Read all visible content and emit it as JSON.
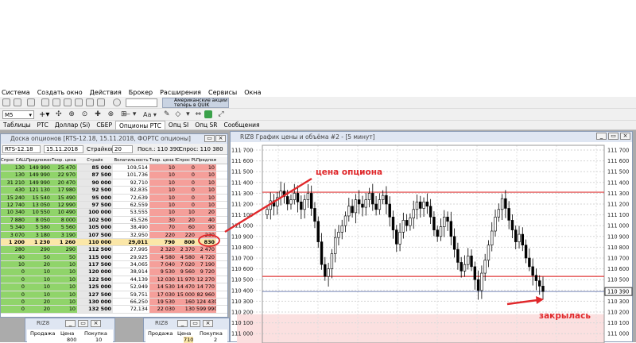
{
  "menu": [
    "Система",
    "Создать окно",
    "Действия",
    "Брокер",
    "Расширения",
    "Сервисы",
    "Окна"
  ],
  "toolbar": {
    "interval": "M5",
    "banner_line1": "Американские акции",
    "banner_line2": "теперь в QUIK"
  },
  "tabs": [
    "Таблицы",
    "РТС",
    "Доллар (Si)",
    "СБЕР",
    "Опционы РТС",
    "Опц SI",
    "Опц SR",
    "Сообщения"
  ],
  "active_tab_index": 4,
  "desk": {
    "title": "Доска опционов [RTS-12.18, 15.11.2018, ФОРТС опционы]",
    "series": "RTS-12.18",
    "date": "15.11.2018",
    "strikes_label": "Страйков:",
    "strikes_value": "20",
    "last_label": "Посл.: 110 390",
    "ask_label": "Спрос: 110 380",
    "headers": [
      "Спрос CALL",
      "Предложение",
      "Теор. цена CALL",
      "Страйк",
      "Волатильность",
      "Теор. цена PUT",
      "Спрос PUT",
      "Предлож. PUT"
    ],
    "rows": [
      [
        "130",
        "149 990",
        "25 470",
        "85 000",
        "109,514",
        "10",
        "0",
        "10"
      ],
      [
        "130",
        "149 990",
        "22 970",
        "87 500",
        "101,736",
        "10",
        "0",
        "10"
      ],
      [
        "31 210",
        "149 990",
        "20 470",
        "90 000",
        "92,710",
        "10",
        "0",
        "10"
      ],
      [
        "430",
        "121 130",
        "17 980",
        "92 500",
        "82,835",
        "10",
        "0",
        "10"
      ],
      [
        "15 240",
        "15 540",
        "15 490",
        "95 000",
        "72,639",
        "10",
        "0",
        "10"
      ],
      [
        "12 740",
        "13 050",
        "12 990",
        "97 500",
        "62,559",
        "10",
        "0",
        "10"
      ],
      [
        "10 340",
        "10 550",
        "10 490",
        "100 000",
        "53,555",
        "10",
        "10",
        "20"
      ],
      [
        "7 880",
        "8 050",
        "8 000",
        "102 500",
        "45,526",
        "30",
        "20",
        "40"
      ],
      [
        "5 340",
        "5 580",
        "5 560",
        "105 000",
        "38,490",
        "70",
        "60",
        "90"
      ],
      [
        "3 070",
        "3 180",
        "3 190",
        "107 500",
        "32,950",
        "220",
        "220",
        "230"
      ],
      [
        "1 200",
        "1 230",
        "1 260",
        "110 000",
        "29,011",
        "790",
        "800",
        "830"
      ],
      [
        "280",
        "290",
        "290",
        "112 500",
        "27,995",
        "2 320",
        "2 370",
        "2 470"
      ],
      [
        "40",
        "50",
        "50",
        "115 000",
        "29,925",
        "4 580",
        "4 580",
        "4 720"
      ],
      [
        "10",
        "20",
        "10",
        "117 500",
        "34,065",
        "7 040",
        "7 020",
        "7 190"
      ],
      [
        "0",
        "10",
        "10",
        "120 000",
        "38,914",
        "9 530",
        "9 560",
        "9 720"
      ],
      [
        "0",
        "10",
        "10",
        "122 500",
        "44,139",
        "12 030",
        "11 970",
        "12 270"
      ],
      [
        "0",
        "10",
        "10",
        "125 000",
        "52,949",
        "14 530",
        "14 470",
        "14 770"
      ],
      [
        "0",
        "10",
        "10",
        "127 500",
        "59,751",
        "17 030",
        "15 000",
        "82 960"
      ],
      [
        "0",
        "20",
        "10",
        "130 000",
        "66,250",
        "19 530",
        "160",
        "124 430"
      ],
      [
        "0",
        "20",
        "10",
        "132 500",
        "72,134",
        "22 030",
        "130",
        "599 990"
      ]
    ],
    "atm_row_index": 10
  },
  "small1": {
    "title": "RIZ8",
    "sell": "Продажа",
    "price": "Цена",
    "buy": "Покупка",
    "row": [
      "",
      "800",
      "10"
    ]
  },
  "small2": {
    "title": "RIZ8",
    "sell": "Продажа",
    "price": "Цена",
    "buy": "Покупка",
    "row": [
      "",
      "710",
      "2"
    ]
  },
  "chart": {
    "title": "RIZ8 График цены и объёма #2 - [5 минут]",
    "current_price_label": "110 390",
    "ann_price": "цена опциона",
    "ann_close": "закрылась"
  },
  "chart_data": {
    "type": "candlestick",
    "ylim": [
      110050,
      111700
    ],
    "y_ticks": [
      111700,
      111600,
      111500,
      111400,
      111300,
      111200,
      111100,
      111000,
      110900,
      110800,
      110700,
      110600,
      110500,
      110400,
      110300,
      110200,
      110100,
      110000
    ],
    "y_tick_labels": [
      "111 700",
      "111 600",
      "111 500",
      "111 400",
      "111 300",
      "111 200",
      "111 100",
      "111 000",
      "110 900",
      "110 800",
      "110 700",
      "110 600",
      "110 500",
      "110 400",
      "110 300",
      "110 200",
      "110 100",
      "111 000"
    ],
    "levels": [
      111310,
      110530
    ],
    "current_price": 110390,
    "closes": [
      111150,
      111230,
      111180,
      111260,
      111320,
      111270,
      111200,
      111240,
      111300,
      111220,
      111150,
      111240,
      111300,
      111160,
      111040,
      110850,
      110640,
      110530,
      110600,
      110740,
      110890,
      110940,
      111000,
      111090,
      111180,
      111120,
      111240,
      111200,
      111170,
      111240,
      111300,
      111200,
      111150,
      111240,
      111280,
      111200,
      111080,
      110960,
      110830,
      110940,
      111050,
      111000,
      111070,
      111150,
      111220,
      111160,
      111220,
      111180,
      111080,
      110960,
      110900,
      110990,
      111080,
      111040,
      110900,
      110780,
      110660,
      110580,
      110640,
      110720,
      110620,
      110500,
      110400,
      110560,
      110680,
      110820,
      110950,
      111080,
      111150,
      111250,
      111160,
      111050,
      110960,
      110850,
      110920,
      110820,
      110700,
      110620,
      110540,
      110490,
      110440,
      110390
    ],
    "opens": [
      111100,
      111150,
      111230,
      111180,
      111260,
      111320,
      111270,
      111200,
      111240,
      111300,
      111220,
      111150,
      111240,
      111300,
      111160,
      111040,
      110850,
      110640,
      110530,
      110600,
      110740,
      110890,
      110940,
      111000,
      111090,
      111180,
      111120,
      111240,
      111200,
      111170,
      111240,
      111300,
      111200,
      111150,
      111240,
      111280,
      111200,
      111080,
      110960,
      110830,
      110940,
      111050,
      111000,
      111070,
      111150,
      111220,
      111160,
      111220,
      111180,
      111080,
      110960,
      110900,
      110990,
      111080,
      111040,
      110900,
      110780,
      110660,
      110580,
      110640,
      110720,
      110620,
      110500,
      110400,
      110560,
      110680,
      110820,
      110950,
      111080,
      111150,
      111250,
      111160,
      111050,
      110960,
      110850,
      110920,
      110820,
      110700,
      110620,
      110540,
      110490,
      110440
    ]
  },
  "colors": {
    "bull": "#ffffff",
    "bear": "#000000",
    "level": "#e03a3a",
    "current": "#4a5fa0",
    "call_bg": "#90d46a",
    "put_bg": "#f59f9a",
    "atm_bg": "#fbe7a8",
    "ann": "#e0282b"
  }
}
